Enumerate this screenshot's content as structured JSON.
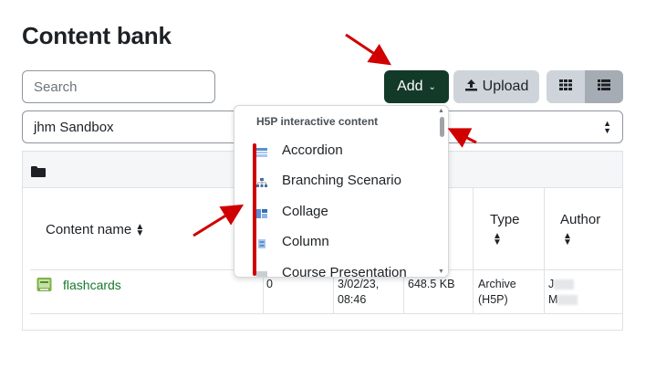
{
  "page": {
    "title": "Content bank"
  },
  "search": {
    "placeholder": "Search"
  },
  "toolbar": {
    "add_label": "Add",
    "upload_label": "Upload"
  },
  "context": {
    "selected": "jhm Sandbox"
  },
  "table": {
    "headers": {
      "name": "Content name",
      "type": "Type",
      "author": "Author"
    },
    "rows": [
      {
        "name": "flashcards",
        "count": "0",
        "modified_line1": "3/02/23,",
        "modified_line2": "08:46",
        "size": "648.5 KB",
        "type_line1": "Archive",
        "type_line2": "(H5P)",
        "author_line1": "J",
        "author_line2": "M"
      }
    ]
  },
  "add_menu": {
    "header": "H5P interactive content",
    "items": [
      {
        "label": "Accordion",
        "icon": "accordion-icon"
      },
      {
        "label": "Branching Scenario",
        "icon": "branching-scenario-icon"
      },
      {
        "label": "Collage",
        "icon": "collage-icon"
      },
      {
        "label": "Column",
        "icon": "column-icon"
      },
      {
        "label": "Course Presentation",
        "icon": "course-presentation-icon"
      }
    ]
  },
  "colors": {
    "add_button": "#133a28",
    "link": "#167a2c",
    "annotation": "#d00000"
  }
}
